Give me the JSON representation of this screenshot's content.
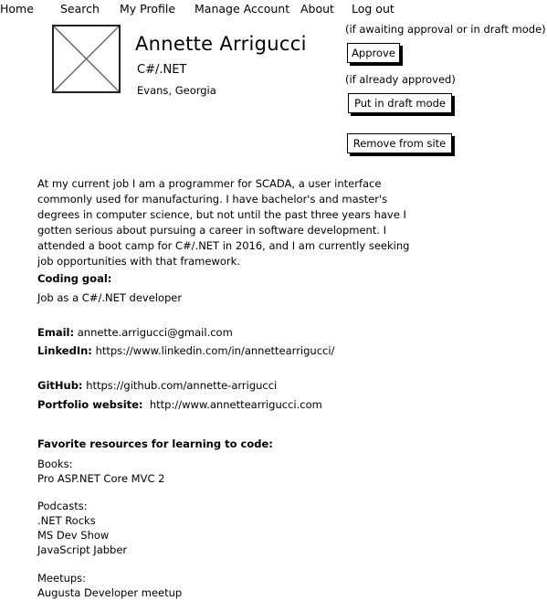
{
  "nav": {
    "items": [
      "Home",
      "Search",
      "My Profile",
      "Manage Account",
      "About",
      "Log out"
    ]
  },
  "profile": {
    "name": "Annette Arrigucci",
    "title": "C#/.NET",
    "location": "Evans, Georgia",
    "about": "At my current job I am a programmer for SCADA, a user interface commonly used for manufacturing. I have bachelor's and master's degrees in computer science, but not until the past three years have I gotten serious about pursuing a career in software development. I attended a boot camp for C#/.NET in 2016, and I am currently seeking job opportunities with that framework.",
    "coding_goal_label": "Coding goal:",
    "coding_goal": "Job as a C#/.NET developer",
    "email_label": "Email:",
    "email": "annette.arrigucci@gmail.com",
    "linkedin_label": "LinkedIn:",
    "linkedin": "https://www.linkedin.com/in/annettearrigucci/",
    "github_label": "GitHub:",
    "github": "https://github.com/annette-arrigucci",
    "portfolio_label": "Portfolio website:",
    "portfolio": "http://www.annettearrigucci.com"
  },
  "admin": {
    "awaiting_note": "(if awaiting approval or in draft mode)",
    "approve_label": "Approve",
    "approved_note": "(if already approved)",
    "draft_label": "Put in draft mode",
    "remove_label": "Remove from site"
  },
  "resources": {
    "heading": "Favorite resources for learning to code:",
    "books_label": "Books:",
    "books": [
      "Pro ASP.NET Core MVC 2"
    ],
    "podcasts_label": "Podcasts:",
    "podcasts": [
      ".NET Rocks",
      "MS Dev Show",
      "JavaScript Jabber"
    ],
    "meetups_label": "Meetups:",
    "meetups": [
      "Augusta Developer meetup"
    ]
  }
}
